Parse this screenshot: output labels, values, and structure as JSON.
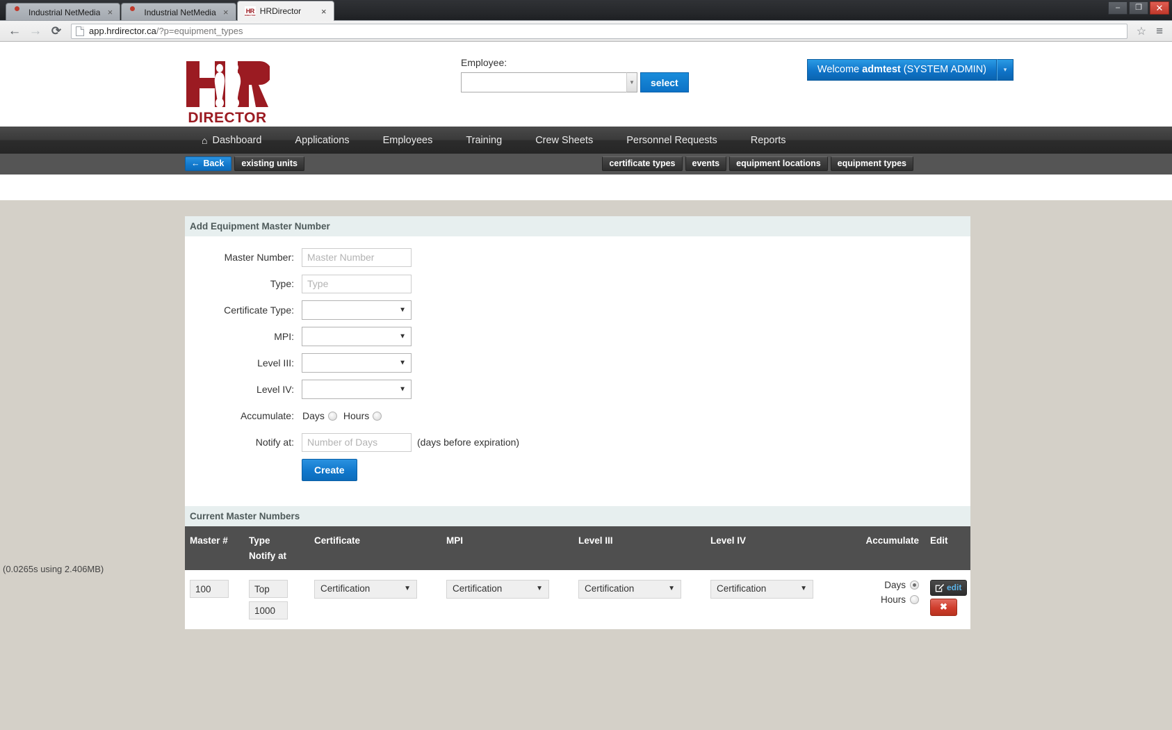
{
  "browser": {
    "tabs": [
      {
        "title": "Industrial NetMedia",
        "favicon": "box-icon",
        "active": false,
        "close": "×"
      },
      {
        "title": "Industrial NetMedia",
        "favicon": "box-icon",
        "active": false,
        "close": "×"
      },
      {
        "title": "HRDirector",
        "favicon": "hr-logo-icon",
        "active": true,
        "close": "×"
      }
    ],
    "window_controls": {
      "minimize": "–",
      "maximize": "❐",
      "close": "✕"
    },
    "toolbar": {
      "back_icon": "←",
      "forward_icon": "→",
      "reload_icon": "⟳",
      "url_host": "app.hrdirector.ca",
      "url_path": "/?p=equipment_types",
      "bookmark_icon": "☆",
      "menu_icon": "≡"
    }
  },
  "header": {
    "logo_word": "DIRECTOR",
    "logo_letters": "HR",
    "employee_label": "Employee:",
    "employee_value": "",
    "employee_placeholder": "",
    "employee_caret": "▼",
    "select_label": "select",
    "welcome_prefix": "Welcome ",
    "welcome_user": "admtest",
    "welcome_role": " (SYSTEM ADMIN)",
    "welcome_caret": "▾"
  },
  "mainnav": {
    "items": [
      {
        "label": "Dashboard",
        "icon": "home-icon"
      },
      {
        "label": "Applications",
        "icon": ""
      },
      {
        "label": "Employees",
        "icon": ""
      },
      {
        "label": "Training",
        "icon": ""
      },
      {
        "label": "Crew Sheets",
        "icon": ""
      },
      {
        "label": "Personnel Requests",
        "icon": ""
      },
      {
        "label": "Reports",
        "icon": ""
      }
    ]
  },
  "subnav": {
    "back_label": "Back",
    "back_icon": "←",
    "left_items": [
      {
        "label": "existing units"
      }
    ],
    "right_items": [
      {
        "label": "certificate types"
      },
      {
        "label": "events"
      },
      {
        "label": "equipment locations"
      },
      {
        "label": "equipment types"
      }
    ]
  },
  "form": {
    "panel_title": "Add Equipment Master Number",
    "fields": [
      {
        "label": "Master Number:",
        "type": "text",
        "value": "",
        "placeholder": "Master Number",
        "name": "master-number"
      },
      {
        "label": "Type:",
        "type": "text",
        "value": "",
        "placeholder": "Type",
        "name": "type"
      },
      {
        "label": "Certificate Type:",
        "type": "select",
        "value": "",
        "name": "certificate-type"
      },
      {
        "label": "MPI:",
        "type": "select",
        "value": "",
        "name": "mpi"
      },
      {
        "label": "Level III:",
        "type": "select",
        "value": "",
        "name": "level-iii"
      },
      {
        "label": "Level IV:",
        "type": "select",
        "value": "",
        "name": "level-iv"
      }
    ],
    "accumulate_label": "Accumulate:",
    "accumulate_options": [
      {
        "label": "Days",
        "checked": false
      },
      {
        "label": "Hours",
        "checked": false
      }
    ],
    "notify_label": "Notify at:",
    "notify_value": "",
    "notify_placeholder": "Number of Days",
    "notify_hint": "(days before expiration)",
    "create_label": "Create",
    "select_caret": "▼"
  },
  "table": {
    "panel_title": "Current Master Numbers",
    "columns": [
      {
        "label": "Master #",
        "sub": ""
      },
      {
        "label": "Type",
        "sub": "Notify at"
      },
      {
        "label": "Certificate",
        "sub": ""
      },
      {
        "label": "MPI",
        "sub": ""
      },
      {
        "label": "Level III",
        "sub": ""
      },
      {
        "label": "Level IV",
        "sub": ""
      },
      {
        "label": "Accumulate",
        "sub": ""
      },
      {
        "label": "Edit",
        "sub": ""
      }
    ],
    "rows": [
      {
        "master_number": "100",
        "type": "Top",
        "notify_at": "1000",
        "certificate": "Certification",
        "mpi": "Certification",
        "level_iii": "Certification",
        "level_iv": "Certification",
        "accumulate": [
          {
            "label": "Days",
            "checked": true
          },
          {
            "label": "Hours",
            "checked": false
          }
        ],
        "edit_label": "edit",
        "edit_icon": "pencil-square-icon",
        "delete_icon": "✖"
      }
    ],
    "caret": "▼"
  },
  "footer": {
    "note": "(0.0265s using 2.406MB)"
  },
  "colors": {
    "brand_red": "#9b1b22",
    "accent_blue": "#0f74c8",
    "nav_dark": "#333333",
    "panel_head": "#e7efef",
    "table_head": "#4f4f4f",
    "danger_red": "#cf3c2c"
  }
}
